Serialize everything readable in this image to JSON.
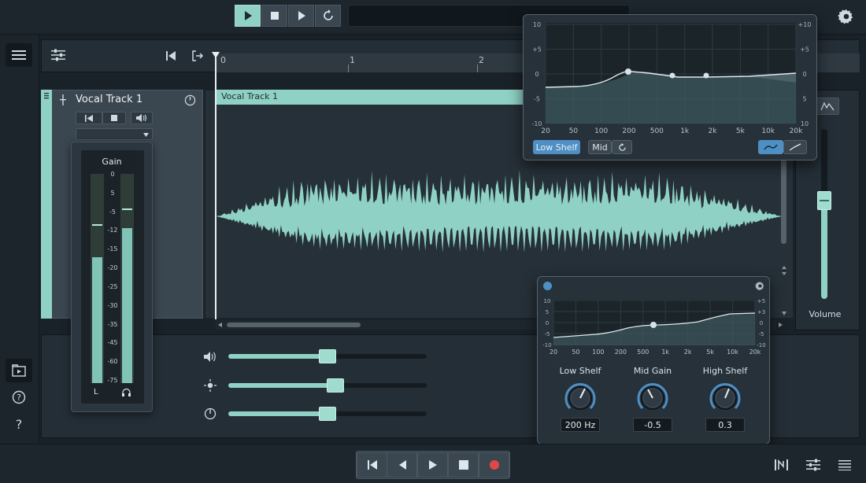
{
  "track": {
    "name": "Vocal Track 1",
    "clip_name": "Vocal Track 1"
  },
  "ruler": {
    "marks": [
      "0",
      "1",
      "2"
    ]
  },
  "meter": {
    "title": "Gain",
    "scale": [
      "0",
      "5",
      "-5",
      "-12",
      "-15",
      "-20",
      "-25",
      "-30",
      "-35",
      "-45",
      "-60",
      "-75"
    ],
    "channel_left": "L",
    "levels": {
      "left": 0.6,
      "right": 0.74
    }
  },
  "mixer": {
    "volume_label": "Volume",
    "volume_level": 0.58,
    "rows": [
      {
        "icon": "speaker-icon",
        "level": 0.5
      },
      {
        "icon": "sun-icon",
        "level": 0.54
      },
      {
        "icon": "gauge-icon",
        "level": 0.5
      }
    ]
  },
  "eq_top": {
    "y_left": [
      "10",
      "+5",
      "0",
      "-5",
      "-10"
    ],
    "y_right": [
      "+10",
      "+5",
      "0",
      "5",
      "10"
    ],
    "x_ticks": [
      "20",
      "50",
      "100",
      "200",
      "500",
      "1k",
      "2k",
      "5k",
      "10k",
      "20k"
    ],
    "bands": [
      {
        "label": "Low Shelf",
        "active": true
      },
      {
        "label": "Mid",
        "active": false
      }
    ]
  },
  "eq_bottom": {
    "y_left": [
      "10",
      "5",
      "0",
      "-5",
      "-10"
    ],
    "y_right": [
      "+5",
      "+3",
      "0",
      "-5",
      "-10"
    ],
    "x_ticks": [
      "20",
      "50",
      "100",
      "200",
      "500",
      "1k",
      "2k",
      "5k",
      "10k",
      "20k"
    ],
    "knobs": [
      {
        "label": "Low Shelf",
        "value": "200 Hz"
      },
      {
        "label": "Mid Gain",
        "value": "-0.5"
      },
      {
        "label": "High Shelf",
        "value": "0.3"
      }
    ]
  },
  "colors": {
    "accent": "#8fd1c4",
    "record": "#e04848",
    "active_band": "#4f8fc4"
  }
}
